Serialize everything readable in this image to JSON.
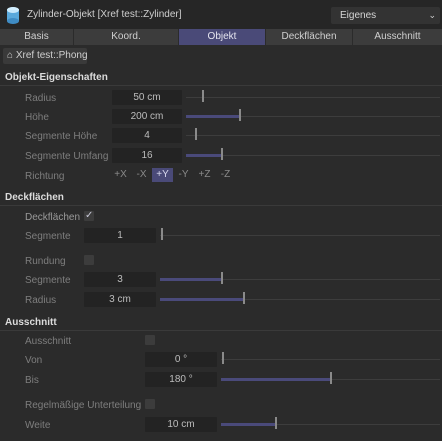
{
  "header": {
    "title": "Zylinder-Objekt [Xref test::Zylinder]",
    "mode": "Eigenes"
  },
  "tabs": [
    {
      "label": "Basis",
      "active": false
    },
    {
      "label": "Koord.",
      "active": false
    },
    {
      "label": "Objekt",
      "active": true
    },
    {
      "label": "Deckflächen",
      "active": false
    },
    {
      "label": "Ausschnitt",
      "active": false
    }
  ],
  "material_tag": "Xref test::Phong",
  "object_props": {
    "title": "Objekt-Eigenschaften",
    "radius": {
      "label": "Radius",
      "value": "50 cm"
    },
    "height": {
      "label": "Höhe",
      "value": "200 cm"
    },
    "height_segments": {
      "label": "Segmente Höhe",
      "value": "4"
    },
    "rotation_segments": {
      "label": "Segmente Umfang",
      "value": "16"
    },
    "orientation": {
      "label": "Richtung",
      "options": [
        "+X",
        "-X",
        "+Y",
        "-Y",
        "+Z",
        "-Z"
      ],
      "selected": "+Y"
    }
  },
  "caps": {
    "title": "Deckflächen",
    "caps": {
      "label": "Deckflächen",
      "checked": true
    },
    "segments": {
      "label": "Segmente",
      "value": "1"
    },
    "fillet": {
      "label": "Rundung",
      "checked": false
    },
    "fillet_segments": {
      "label": "Segmente",
      "value": "3"
    },
    "fillet_radius": {
      "label": "Radius",
      "value": "3 cm"
    }
  },
  "slice": {
    "title": "Ausschnitt",
    "slice": {
      "label": "Ausschnitt",
      "checked": false
    },
    "from": {
      "label": "Von",
      "value": "0 °"
    },
    "to": {
      "label": "Bis",
      "value": "180 °"
    },
    "regular_grid": {
      "label": "Regelmäßige Unterteilung",
      "checked": false
    },
    "width": {
      "label": "Weite",
      "value": "10 cm"
    }
  },
  "colors": {
    "accent": "#4a4a78",
    "background": "#2b2b2b",
    "field": "#232323"
  }
}
